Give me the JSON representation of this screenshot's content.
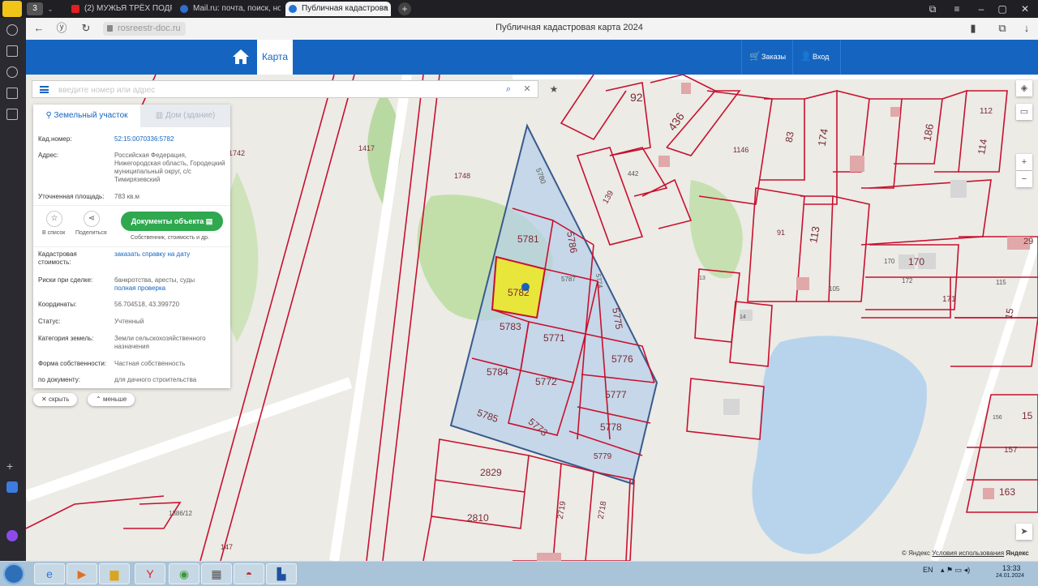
{
  "browser": {
    "tab_count": "3",
    "tabs": [
      {
        "label": "(2) МУЖЬЯ ТРЁХ ПОДРУГ",
        "color": "#e02020"
      },
      {
        "label": "Mail.ru: почта, поиск, нов",
        "color": "#2f6fd0"
      },
      {
        "label": "Публичная кадастрова",
        "color": "#1f74d6"
      }
    ],
    "url": "rosreestr-doc.ru",
    "page_title": "Публичная кадастровая карта 2024"
  },
  "header": {
    "map_tab": "Карта",
    "orders": "Заказы",
    "login": "Вход"
  },
  "search": {
    "placeholder": "введите номер или адрес"
  },
  "panel": {
    "tab_land": "Земельный участок",
    "tab_house": "Дом (здание)",
    "fields": {
      "cad_num_label": "Кад.номер:",
      "cad_num_value": "52:15:0070336:5782",
      "address_label": "Адрес:",
      "address_value": "Российская Федерация, Нижегородская область, Городецкий муниципальный округ, с/с Тимирязевский",
      "area_label": "Уточненная площадь:",
      "area_value": "783 кв.м",
      "cost_label": "Кадастровая стоимость:",
      "cost_value": "заказать справку на дату",
      "risks_label": "Риски при сделке:",
      "risks_value": "банкротства, аресты, суды",
      "risks_link": "полная проверка",
      "coords_label": "Координаты:",
      "coords_value": "56.704518, 43.399720",
      "status_label": "Статус:",
      "status_value": "Учтенный",
      "category_label": "Категория земель:",
      "category_value": "Земли сельскохозяйственного назначения",
      "ownership_label": "Форма собственности:",
      "ownership_value": "Частная собственность",
      "document_label": "по документу:",
      "document_value": "для дачного строительства"
    },
    "actions": {
      "list_label": "В список",
      "share_label": "Поделиться",
      "docs_button": "Документы объекта",
      "docs_sub": "Собственник, стоимость и др."
    },
    "hide_label": "скрыть",
    "less_label": "меньше"
  },
  "map": {
    "parcel_labels": [
      "5780",
      "5781",
      "5782",
      "5787",
      "5786",
      "5783",
      "5771",
      "5774",
      "5775",
      "5784",
      "5772",
      "5776",
      "5785",
      "5773",
      "5777",
      "5778",
      "5779",
      "92",
      "436",
      "83",
      "174",
      "186",
      "112",
      "114",
      "1146",
      "442",
      "139",
      "91",
      "113",
      "105",
      "170",
      "172",
      "171",
      "115",
      "13",
      "14",
      "1417",
      "1748",
      "1742",
      "2829",
      "2810",
      "2719",
      "2718",
      "1386/12",
      "147",
      "163",
      "156",
      "157",
      "15",
      "15",
      "29",
      "170"
    ]
  },
  "attribution": {
    "copyright": "© Яндекс",
    "terms": "Условия использования",
    "brand": "Яндекс"
  },
  "taskbar": {
    "lang": "EN",
    "time": "13:33",
    "date": "24.01.2024"
  },
  "colors": {
    "header_blue": "#1565c0",
    "parcel_red": "#c8102e",
    "selected_yellow": "#e8e63a",
    "group_fill": "#b8d0e8",
    "doc_green": "#2fa84f"
  }
}
